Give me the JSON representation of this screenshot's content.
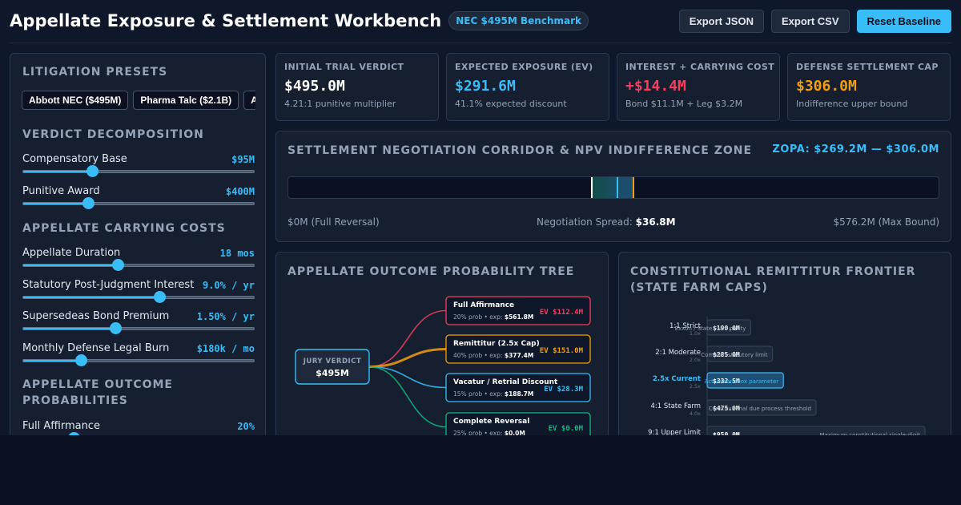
{
  "header": {
    "title": "Appellate Exposure & Settlement Workbench",
    "benchmark_badge": "NEC $495M Benchmark",
    "export_json": "Export JSON",
    "export_csv": "Export CSV",
    "reset_baseline": "Reset Baseline"
  },
  "sidebar": {
    "presets_title": "LITIGATION PRESETS",
    "presets": [
      "Abbott NEC ($495M)",
      "Pharma Talc ($2.1B)",
      "A"
    ],
    "decomposition_title": "VERDICT DECOMPOSITION",
    "compensatory": {
      "label": "Compensatory Base",
      "value": "$95M",
      "level": 0.3
    },
    "punitive": {
      "label": "Punitive Award",
      "value": "$400M",
      "level": 0.28
    },
    "carrying_title": "APPELLATE CARRYING COSTS",
    "duration": {
      "label": "Appellate Duration",
      "value": "18 mos",
      "level": 0.41
    },
    "interest": {
      "label": "Statutory Post-Judgment Interest",
      "value": "9.0% / yr",
      "level": 0.59
    },
    "bond": {
      "label": "Supersedeas Bond Premium",
      "value": "1.50% / yr",
      "level": 0.4
    },
    "burn": {
      "label": "Monthly Defense Legal Burn",
      "value": "$180k / mo",
      "level": 0.25
    },
    "outcomes_title": "APPELLATE OUTCOME PROBABILITIES",
    "affirmance": {
      "label": "Full Affirmance",
      "value": "20%",
      "level": 0.22
    }
  },
  "kpis": {
    "verdict": {
      "title": "INITIAL TRIAL VERDICT",
      "value": "$495.0M",
      "sub": "4.21:1 punitive multiplier",
      "color": "#ffffff"
    },
    "ev": {
      "title": "EXPECTED EXPOSURE (EV)",
      "value": "$291.6M",
      "sub": "41.1% expected discount",
      "color": "#38bdf8"
    },
    "interest": {
      "title": "INTEREST + CARRYING COST",
      "value": "+$14.4M",
      "sub": "Bond $11.1M + Leg $3.2M",
      "color": "#f43f5e"
    },
    "cap": {
      "title": "DEFENSE SETTLEMENT CAP",
      "value": "$306.0M",
      "sub": "Indifference upper bound",
      "color": "#f59e0b"
    }
  },
  "corridor": {
    "title": "SETTLEMENT NEGOTIATION CORRIDOR & NPV INDIFFERENCE ZONE",
    "zopa": "ZOPA: $269.2M — $306.0M",
    "left_label": "$0M (Full Reversal)",
    "spread_label": "Negotiation Spread:",
    "spread_value": "$36.8M",
    "right_label": "$576.2M (Max Bound)",
    "axis_max": 576.2,
    "zopa_low": 269.2,
    "zopa_high": 306.0,
    "ev": 291.6,
    "cap": 306.0
  },
  "tree": {
    "title": "APPELLATE OUTCOME PROBABILITY TREE",
    "root_label": "JURY VERDICT",
    "root_value": "$495M",
    "nodes": [
      {
        "name": "Full Affirmance",
        "prob": "20% prob • exp:",
        "exp": "$561.8M",
        "ev": "EV $112.4M",
        "color": "#f43f5e"
      },
      {
        "name": "Remittitur (2.5x Cap)",
        "prob": "40% prob • exp:",
        "exp": "$377.4M",
        "ev": "EV $151.0M",
        "color": "#f59e0b"
      },
      {
        "name": "Vacatur / Retrial Discount",
        "prob": "15% prob • exp:",
        "exp": "$188.7M",
        "ev": "EV $28.3M",
        "color": "#38bdf8"
      },
      {
        "name": "Complete Reversal",
        "prob": "25% prob • exp:",
        "exp": "$0.0M",
        "ev": "EV $0.0M",
        "color": "#10b981"
      }
    ]
  },
  "frontier": {
    "title": "CONSTITUTIONAL REMITTITUR FRONTIER (STATE FARM CAPS)",
    "axis_max": 950,
    "rows": [
      {
        "label": "1:1 Strict",
        "ratio": "1.0x",
        "value": "$190.0M",
        "note": "Exxon / State Farm parity",
        "amount": 190,
        "active": false
      },
      {
        "label": "2:1 Moderate",
        "ratio": "2.0x",
        "value": "$285.0M",
        "note": "Common statutory limit",
        "amount": 285,
        "active": false
      },
      {
        "label": "2.5x Current",
        "ratio": "2.5x",
        "value": "$332.5M",
        "note": "Active sandbox parameter",
        "amount": 332.5,
        "active": true
      },
      {
        "label": "4:1 State Farm",
        "ratio": "4.0x",
        "value": "$475.0M",
        "note": "Constitutional due process threshold",
        "amount": 475,
        "active": false
      },
      {
        "label": "9:1 Upper Limit",
        "ratio": "9.0x",
        "value": "$950.0M",
        "note": "Maximum constitutional single-digit",
        "amount": 950,
        "active": false
      }
    ]
  },
  "colors": {
    "accent": "#38bdf8",
    "danger": "#f43f5e",
    "warning": "#f59e0b",
    "success": "#10b981",
    "panel": "#151f30"
  }
}
